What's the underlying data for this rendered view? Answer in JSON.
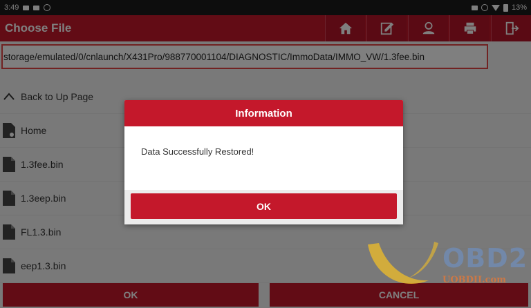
{
  "statusbar": {
    "time": "3:49",
    "battery": "13%"
  },
  "header": {
    "title": "Choose File",
    "icons": [
      "home-icon",
      "edit-icon",
      "user-icon",
      "print-icon",
      "exit-icon"
    ]
  },
  "path": "storage/emulated/0/cnlaunch/X431Pro/988770001104/DIAGNOSTIC/ImmoData/IMMO_VW/1.3fee.bin",
  "list": {
    "back": "Back to Up Page",
    "items": [
      "Home",
      "1.3fee.bin",
      "1.3eep.bin",
      "FL1.3.bin",
      "eep1.3.bin"
    ]
  },
  "buttons": {
    "ok": "OK",
    "cancel": "CANCEL"
  },
  "dialog": {
    "title": "Information",
    "message": "Data Successfully Restored!",
    "ok": "OK"
  },
  "watermark": {
    "brand": "OBD2",
    "site": "UOBDII.com"
  },
  "colors": {
    "accent": "#c4182b",
    "path_border": "#e24444"
  }
}
